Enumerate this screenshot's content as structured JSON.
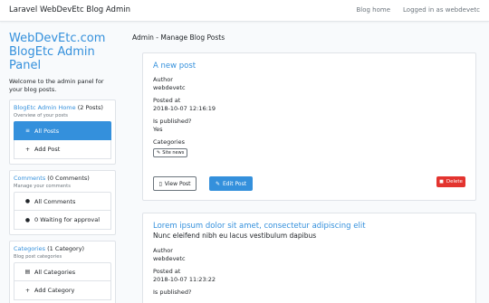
{
  "navbar": {
    "brand": "Laravel WebDevEtc Blog Admin",
    "blog_home": "Blog home",
    "logged_in": "Logged in as webdevetc"
  },
  "sidebar": {
    "title": "WebDevEtc.com BlogEtc Admin Panel",
    "welcome": "Welcome to the admin panel for your blog posts.",
    "sections": [
      {
        "link": "BlogEtc Admin Home",
        "count": " (2 Posts)",
        "desc": "Overview of your posts",
        "items": [
          {
            "icon": "≡",
            "label": "All Posts",
            "active": true
          },
          {
            "icon": "+",
            "label": "Add Post",
            "active": false
          }
        ]
      },
      {
        "link": "Comments",
        "count": " (0 Comments)",
        "desc": "Manage your comments",
        "items": [
          {
            "icon": "●",
            "label": "All Comments",
            "active": false
          },
          {
            "icon": "●",
            "label": "0 Waiting for approval",
            "active": false
          }
        ]
      },
      {
        "link": "Categories",
        "count": " (1 Category)",
        "desc": "Blog post categories",
        "items": [
          {
            "icon": "▤",
            "label": "All Categories",
            "active": false
          },
          {
            "icon": "+",
            "label": "Add Category",
            "active": false
          }
        ]
      }
    ]
  },
  "main": {
    "title": "Admin - Manage Blog Posts",
    "labels": {
      "author": "Author",
      "posted_at": "Posted at",
      "is_published": "Is published?",
      "categories": "Categories"
    },
    "buttons": {
      "view": "View Post",
      "edit": "Edit Post",
      "delete": "Delete"
    },
    "posts": [
      {
        "title": "A new post",
        "subtitle": "",
        "author": "webdevetc",
        "posted_at": "2018-10-07 12:16:19",
        "published": "Yes",
        "category": "Site news"
      },
      {
        "title": "Lorem ipsum dolor sit amet, consectetur adipiscing elit",
        "subtitle": "Nunc eleifend nibh eu lacus vestibulum dapibus",
        "author": "webdevetc",
        "posted_at": "2018-10-07 11:23:22",
        "published": ""
      }
    ]
  }
}
